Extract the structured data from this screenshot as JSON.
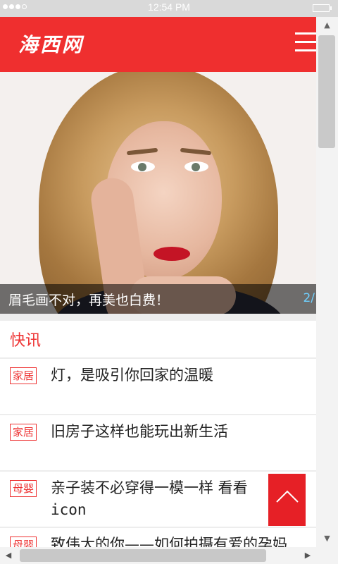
{
  "status_bar": {
    "time": "12:54 PM"
  },
  "header": {
    "logo_text": "海西网",
    "menu_icon": "hamburger-menu-icon",
    "brand_color": "#ef2f2f"
  },
  "banner": {
    "caption": "眉毛画不对，再美也白费！",
    "pager": "2/"
  },
  "section": {
    "title": "快讯"
  },
  "news": [
    {
      "tag": "家居",
      "title": "灯，是吸引你回家的温暖"
    },
    {
      "tag": "家居",
      "title": "旧房子这样也能玩出新生活"
    },
    {
      "tag": "母婴",
      "title": "亲子装不必穿得一模一样 看看",
      "suffix": "icon"
    },
    {
      "tag": "母婴",
      "title": "致伟大的你——如何拍摄有爱的孕妈"
    }
  ],
  "back_to_top": {
    "icon": "chevron-up-icon"
  }
}
